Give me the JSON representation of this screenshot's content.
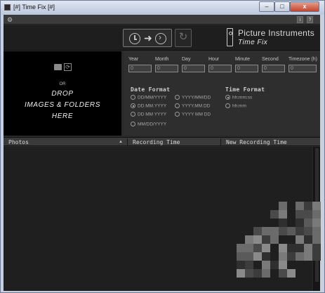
{
  "window": {
    "title": "[#] Time Fix [#]",
    "min": "–",
    "max": "□",
    "close": "x"
  },
  "menubar": {
    "info": "i",
    "help": "?"
  },
  "icons": {
    "gear": "gear-icon",
    "clock": "clock-icon",
    "arrow": "arrow-right-icon",
    "target": "target-icon",
    "undo": "undo-icon",
    "logo": "picture-instruments-logo-icon",
    "folder": "folder-icon",
    "reload": "reload-icon",
    "sort": "sort-up-icon"
  },
  "toolbar": {
    "arrow": "➜",
    "undo": "↻"
  },
  "brand": {
    "line1": "Picture Instruments",
    "line2": "Time Fix"
  },
  "dropzone": {
    "reload": "⟳",
    "or": "OR",
    "line1": "DROP",
    "line2": "IMAGES & FOLDERS",
    "line3": "HERE"
  },
  "offsets": [
    {
      "label": "Year",
      "value": "0"
    },
    {
      "label": "Month",
      "value": "0"
    },
    {
      "label": "Day",
      "value": "0"
    },
    {
      "label": "Hour",
      "value": "0"
    },
    {
      "label": "Minute",
      "value": "0"
    },
    {
      "label": "Second",
      "value": "0"
    },
    {
      "label": "Timezone (h)",
      "value": "0"
    }
  ],
  "date_format": {
    "title": "Date Format",
    "options": [
      {
        "label": "DD/MM/YYYY",
        "checked": false
      },
      {
        "label": "YYYY/MM/DD",
        "checked": false
      },
      {
        "label": "DD.MM.YYYY",
        "checked": true
      },
      {
        "label": "YYYY.MM.DD",
        "checked": false
      },
      {
        "label": "DD MM YYYY",
        "checked": false
      },
      {
        "label": "YYYY MM DD",
        "checked": false
      },
      {
        "label": "MM/DD/YYYY",
        "checked": false
      }
    ]
  },
  "time_format": {
    "title": "Time Format",
    "options": [
      {
        "label": "hh:mm:ss",
        "checked": true
      },
      {
        "label": "hh:mm",
        "checked": false
      }
    ]
  },
  "table": {
    "col_photos": "Photos",
    "col_recording": "Recording Time",
    "col_new": "New Recording Time",
    "sort": "▲"
  },
  "colors": {
    "background": "#2a2a2a",
    "panel": "#2e2e2e",
    "dropzone": "#000000",
    "accent": "#d0d0d0"
  }
}
